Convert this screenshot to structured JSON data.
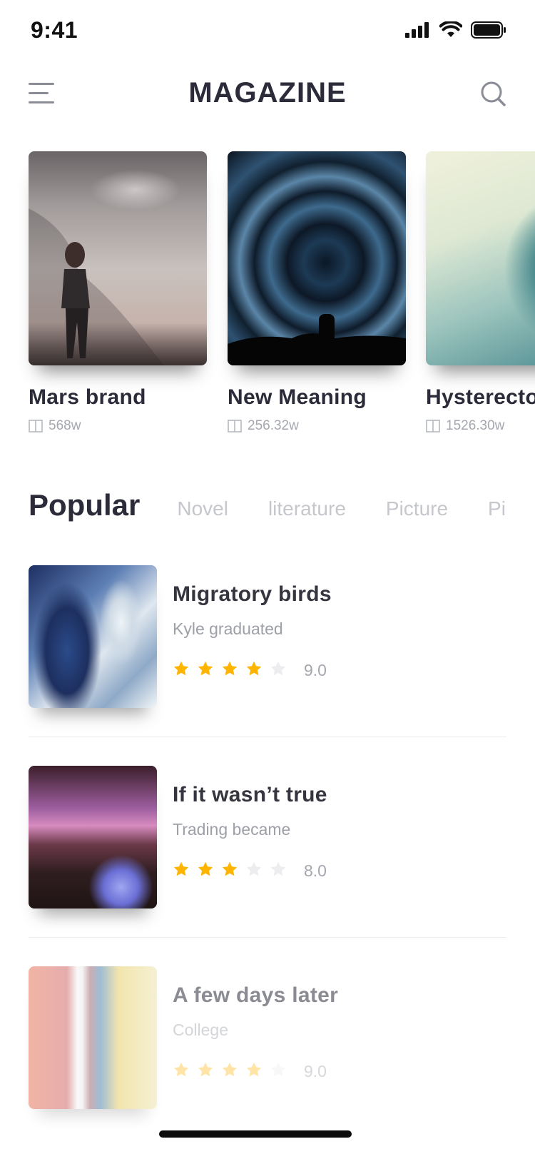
{
  "status_bar": {
    "time": "9:41"
  },
  "header": {
    "title": "MAGAZINE"
  },
  "featured": [
    {
      "title": "Mars brand",
      "reads": "568w"
    },
    {
      "title": "New Meaning",
      "reads": "256.32w"
    },
    {
      "title": "Hysterecto",
      "reads": "1526.30w"
    }
  ],
  "tabs": [
    "Popular",
    "Novel",
    "literature",
    "Picture",
    "Pi"
  ],
  "list": [
    {
      "title": "Migratory birds",
      "author": "Kyle graduated",
      "rating": 4,
      "score": "9.0"
    },
    {
      "title": "If it wasn’t true",
      "author": "Trading became",
      "rating": 3,
      "score": "8.0"
    },
    {
      "title": "A few days later",
      "author": "College",
      "rating": 4,
      "score": "9.0"
    }
  ],
  "colors": {
    "star_active": "#FFB400",
    "star_inactive": "#EDEDF0",
    "title": "#2B2B3A",
    "muted": "#A4A7AE"
  },
  "icons": [
    "menu-icon",
    "search-icon",
    "book-icon",
    "star-icon",
    "signal-icon",
    "wifi-icon",
    "battery-icon"
  ]
}
